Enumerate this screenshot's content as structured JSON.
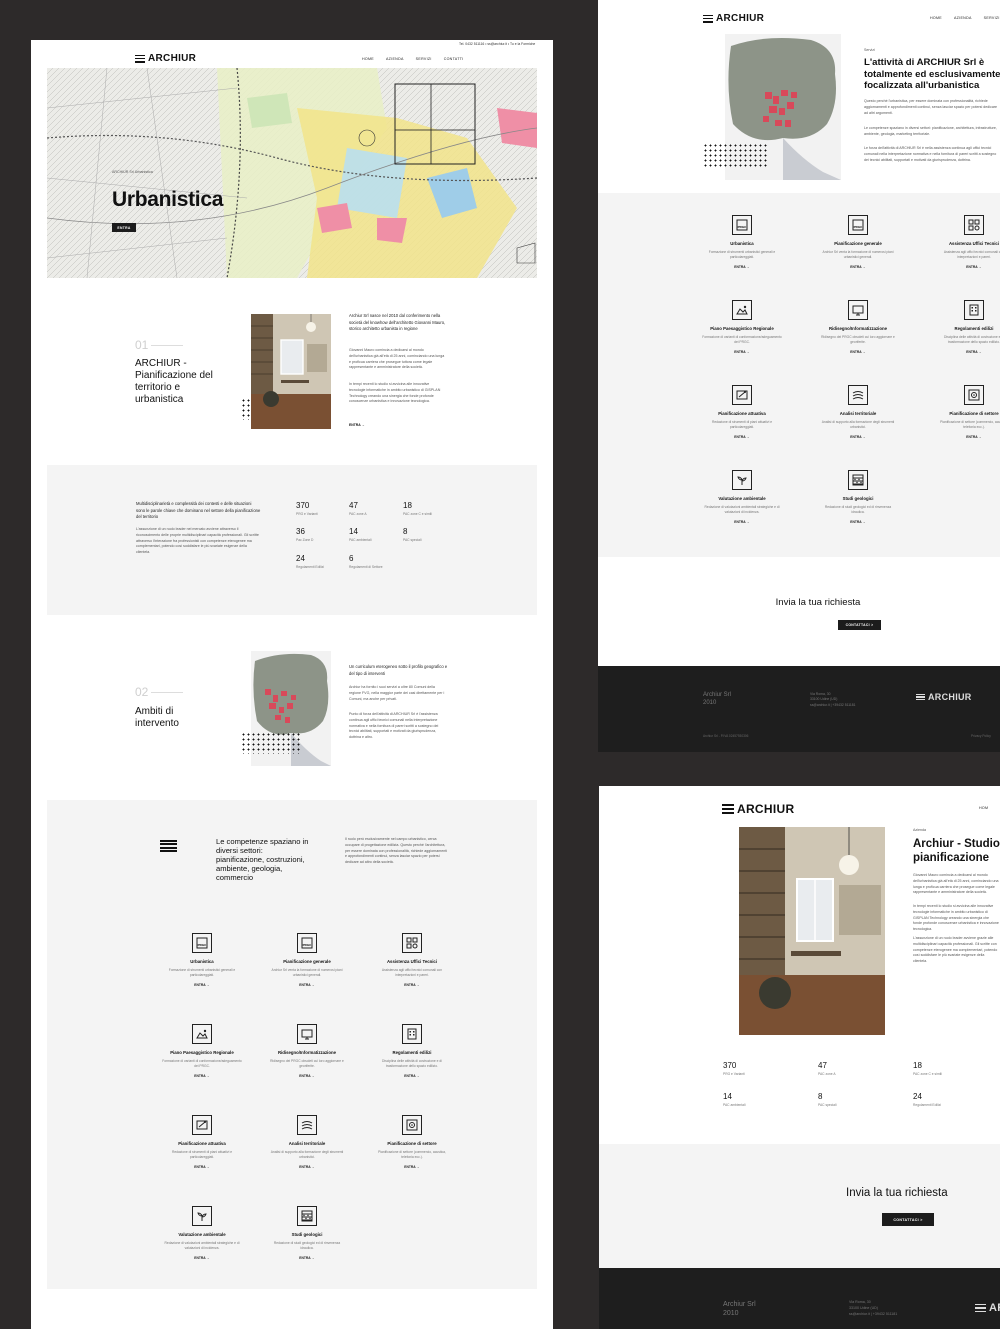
{
  "brand": "ARCHIUR",
  "nav": [
    "HOME",
    "AZIENDA",
    "SERVIZI",
    "CONTATTI"
  ],
  "nav_short": [
    "HOME",
    "AZIENDA",
    "SERVIZI"
  ],
  "nav_single": "HOM",
  "top_info": "Tel. 0432 511116  •  ss@archiur.it  •  Tu e la Formiche",
  "hero": {
    "small": "ARCHIUR Srl Urbanistica",
    "title": "Urbanistica",
    "button": "ENTRA"
  },
  "section1": {
    "num": "01",
    "title": "ARCHIUR - Pianificazione del territorio e urbanistica",
    "lead": "Archiur Srl nasce nel 2010 dal conferimento nella società del knowhow dell'architetto Giovanni Mauro, storico architetto urbanista in regione",
    "p1": "Giovanni Mauro comincia a dedicarsi al mondo dell'urbanistica già all'età di 25 anni, cominciando una lunga e proficua carriera che prosegue tuttora come legale rappresentante e amministratore della società.",
    "p2": "In tempi recenti lo studio si avvicina alle innovative tecnologie informatiche in ambito urbanistico di GISPLAN Technology creando una sinergia che fonde profonde conoscenze urbanistica e innovazione tecnologica.",
    "link": "ENTRA  →"
  },
  "stats_block": {
    "lead": "Multidisciplinarietà e complessità dei contesti e delle situazioni sono le parole chiave che dominano nel settore della pianificazione del territorio",
    "body": "L'assunzione di un ruolo leader nel mercato avviene attraverso il riconoscimento delle proprie multidisciplinari capacità professionali. Gli scritte attraverso l'interazione fra professionisti con competenze eterogenee ma complementari, potendo così soddisfare le più svariate esigenze della clientela."
  },
  "stats": [
    {
      "value": "370",
      "label": "PRG e Varianti"
    },
    {
      "value": "47",
      "label": "PAC zone A"
    },
    {
      "value": "18",
      "label": "PAC zone C e simili"
    },
    {
      "value": "36",
      "label": "Pac Zone D"
    },
    {
      "value": "14",
      "label": "PAC ambientali"
    },
    {
      "value": "8",
      "label": "PAC speciali"
    },
    {
      "value": "24",
      "label": "Regolamenti Edilizi"
    },
    {
      "value": "6",
      "label": "Regolamenti di Settore"
    }
  ],
  "section2": {
    "num": "02",
    "title": "Ambiti di intervento",
    "lead": "Un curriculum eterogeneo sotto il profilo geografico e del tipo di interventi",
    "p1": "Archiur ha fornito i suoi servizi a oltre 80 Comuni della regione FVG, nella maggior parte dei casi direttamente per i Comuni, ma anche per privati.",
    "p2": "Punto di forza dell'attività di ARCHIUR Srl è l'assistenza continua agli uffici tecnici comunali nella interpretazione normativa e nella fornitura di pareri scritti a sostegno dei tecnici abilitati, supportati e motivati da giurisprudenza, dottrina e altro."
  },
  "competenze": {
    "title": "Le competenze spaziano in diversi settori: pianificazione, costruzioni, ambiente, geologia, commercio",
    "body": "Il ruolo però esclusivamente nel campo urbanistico, cerca occupare di progettazione edilizia. Questo perché l'architettura, per essere dominata con professionalità, richiede aggiornamenti e approfondimenti continui, senza lasciar spazio per potersi dedicare ad altro della società."
  },
  "services": [
    {
      "title": "Urbanistica",
      "desc": "Formazione di strumenti urbanistici generali e particolareggiati.",
      "icon": "prgc-icon"
    },
    {
      "title": "Pianificazione generale",
      "desc": "Archiur Srl venta la formazione di numerosi piani urbanistici generali.",
      "icon": "prgc-icon"
    },
    {
      "title": "Assistenza Uffici Tecnici",
      "desc": "Assistenza agli uffici tecnici comunali con interpretazioni e pareri.",
      "icon": "office-icon"
    },
    {
      "title": "Piano Paesaggistico Regionale",
      "desc": "Formazione di varianti di conformazione/adeguamento dei PRGC.",
      "icon": "landscape-icon"
    },
    {
      "title": "Ridisegno/Informatizzazione",
      "desc": "Ridisegno dei PRGC obsoleti cui loro aggiornare e georiferite.",
      "icon": "monitor-icon"
    },
    {
      "title": "Regolamenti edilizi",
      "desc": "Disciplina delle attività di costruzione e di trasformazione dello spazio edilizio.",
      "icon": "building-icon"
    },
    {
      "title": "Pianificazione attuativa",
      "desc": "Redazione di strumenti di piani attuativi e particolareggiati.",
      "icon": "plan-icon"
    },
    {
      "title": "Analisi territoriale",
      "desc": "Analisi di supporto alla formazione degli strumenti urbanistici.",
      "icon": "terrain-icon"
    },
    {
      "title": "Pianificazione di settore",
      "desc": "Pianificazione di settore (commercio, acustica, telefonia ecc.).",
      "icon": "sector-icon"
    },
    {
      "title": "Valutazione ambientale",
      "desc": "Redazione di valutazioni ambientali strategiche e di valutazioni di incidenza.",
      "icon": "sprout-icon"
    },
    {
      "title": "Studi geologici",
      "desc": "Redazione di studi geologici ed di rinvenenza idraulica.",
      "icon": "geology-icon"
    }
  ],
  "servizi_page": {
    "label": "Servizi",
    "title": "L'attività di ARCHIUR Srl è totalmente ed esclusivamente focalizzata all'urbanistica",
    "p1": "Questo perché l'urbanistica, per essere dominata con professionalità, richiede aggiornamenti e approfondimenti continui, senza lasciar spazio per potersi dedicare ad altri argomenti.",
    "p2": "Le competenze spaziano in diversi settori: pianificazione, architettura, infrastrutture, ambiente, geologia, marketing territoriale.",
    "p3": "Le forza dell'attività di ARCHIUR Srl è nella assistenza continua agli uffici tecnici comunali nella interpretazione normativa e nella fornitura di pareri scritti a sostegno dei tecnici abilitati, supportati e motivati da giurisprudenza, dottrina."
  },
  "service_cta": "ENTRA  →",
  "contact": {
    "title": "Invia la tua richiesta",
    "button": "CONTATTACI  >"
  },
  "footer": {
    "company": "Archiur Srl",
    "year": "2010",
    "address1": "Via Roma, 30",
    "address2": "33100 Udine (UD)",
    "email": "ss@archiur.it | +39432 511181",
    "legal": "Archiur Srl - P.IVA 02457930306",
    "privacy": "Privacy Policy"
  },
  "azienda_page": {
    "label": "Azienda",
    "title": "Archiur - Studio e pianificazione",
    "p1": "Giovanni Mauro comincia a dedicarsi al mondo dell'urbanistica già all'età di 25 anni, cominciando una lunga e proficua carriera che prosegue come legale rappresentante e amministratore della società.",
    "p2": "In tempi recenti lo studio si avvicina alle innovative tecnologie informatiche in ambito urbanistico di GISPLAN Technology creando una sinergia che fonde profonde conoscenze urbanistica e innovazione tecnologica.",
    "p3": "L'assunzione di un ruolo leader avviene grazie alle multidisciplinari capacità professionali. Gli scritte con competenze eterogenee ma complementari, potendo così soddisfare le più svariate esigenze della clientela."
  },
  "azienda_stats": [
    {
      "value": "370",
      "label": "PRG e Varianti"
    },
    {
      "value": "47",
      "label": "PAC zone A"
    },
    {
      "value": "18",
      "label": "PAC zone C e simili"
    },
    {
      "value": "14",
      "label": "PAC ambientali"
    },
    {
      "value": "8",
      "label": "PAC speciali"
    },
    {
      "value": "24",
      "label": "Regolamenti Edilizi"
    }
  ],
  "colors": {
    "background": "#2d2a2a",
    "dark": "#1c1c1c",
    "footer": "#1e1e1e",
    "grey_panel": "#f4f4f4",
    "map_red": "#d8495a"
  }
}
